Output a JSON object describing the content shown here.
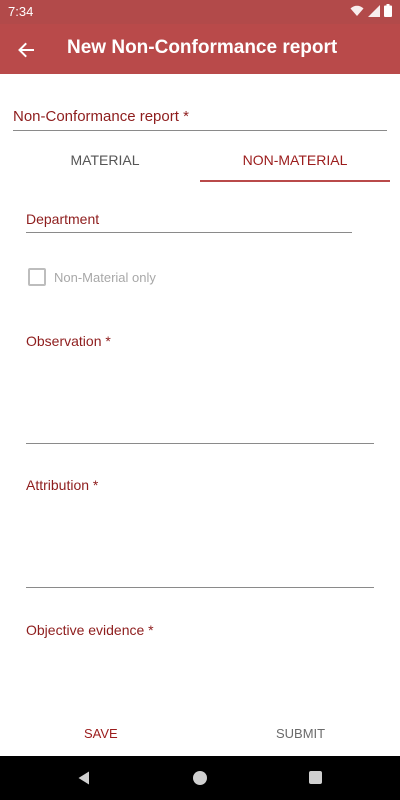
{
  "status_bar": {
    "time": "7:34",
    "icons": [
      "wifi-icon",
      "signal-icon",
      "battery-icon"
    ]
  },
  "app_bar": {
    "title": "New Non-Conformance report",
    "back_icon": "arrow-left-icon",
    "color": "#b94a4a"
  },
  "form": {
    "report_label": "Non-Conformance report *",
    "tabs": [
      {
        "label": "MATERIAL",
        "selected": false
      },
      {
        "label": "NON-MATERIAL",
        "selected": true
      }
    ],
    "department": "Department",
    "checkbox": {
      "label": "Non-Material only",
      "checked": false
    },
    "observation_label": "Observation *",
    "attribution_label": "Attribution *",
    "evidence_label": "Objective evidence *"
  },
  "actions": {
    "save": "SAVE",
    "submit": "SUBMIT"
  },
  "nav_bar": {
    "icons": [
      "back-triangle-icon",
      "home-circle-icon",
      "recents-square-icon"
    ]
  },
  "colors": {
    "accent": "#9b1c1c",
    "primary": "#b94a4a"
  }
}
